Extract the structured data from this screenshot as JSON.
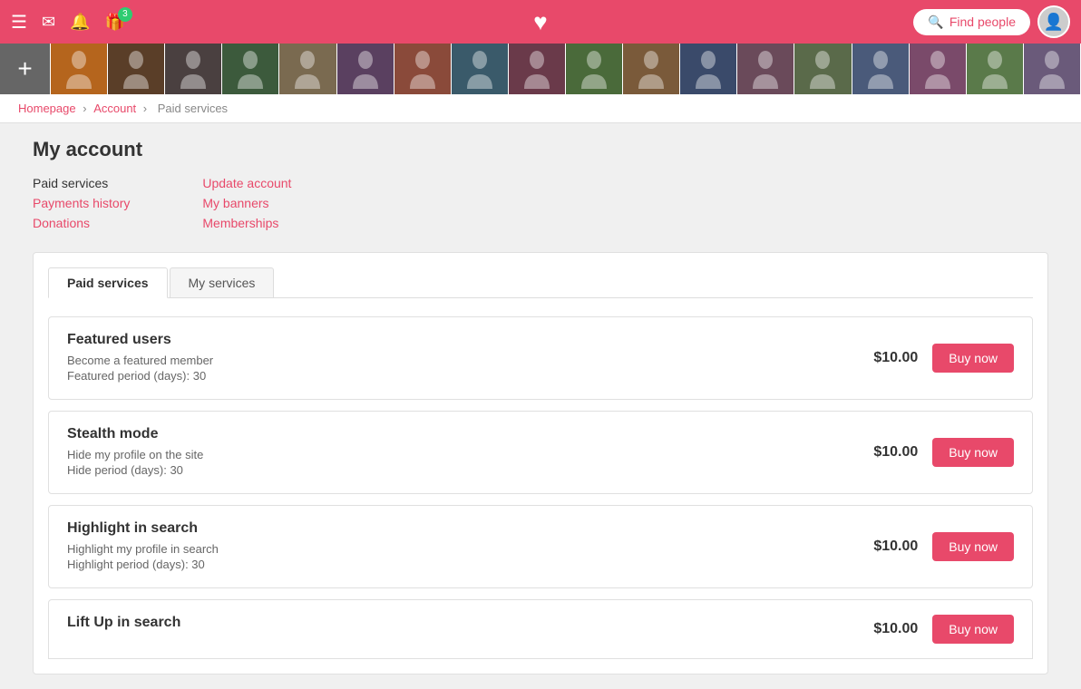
{
  "topnav": {
    "hamburger": "☰",
    "envelope": "✉",
    "bell": "🔔",
    "gift": "🎁",
    "badge_count": "3",
    "heart": "♥",
    "find_people_label": "Find people",
    "avatar_placeholder": "👤"
  },
  "photo_strip": {
    "add_label": "+",
    "photos": [
      {
        "color": "p1",
        "id": "photo-1"
      },
      {
        "color": "p2",
        "id": "photo-2"
      },
      {
        "color": "p3",
        "id": "photo-3"
      },
      {
        "color": "p4",
        "id": "photo-4"
      },
      {
        "color": "p5",
        "id": "photo-5"
      },
      {
        "color": "p6",
        "id": "photo-6"
      },
      {
        "color": "p7",
        "id": "photo-7"
      },
      {
        "color": "p8",
        "id": "photo-8"
      },
      {
        "color": "p9",
        "id": "photo-9"
      },
      {
        "color": "p10",
        "id": "photo-10"
      },
      {
        "color": "p11",
        "id": "photo-11"
      },
      {
        "color": "p12",
        "id": "photo-12"
      },
      {
        "color": "p13",
        "id": "photo-13"
      },
      {
        "color": "p14",
        "id": "photo-14"
      },
      {
        "color": "p15",
        "id": "photo-15"
      },
      {
        "color": "p16",
        "id": "photo-16"
      },
      {
        "color": "p17",
        "id": "photo-17"
      },
      {
        "color": "p18",
        "id": "photo-18"
      }
    ]
  },
  "breadcrumb": {
    "homepage": "Homepage",
    "account": "Account",
    "current": "Paid services"
  },
  "page": {
    "title": "My account"
  },
  "account_menu": {
    "col1": [
      {
        "type": "text",
        "label": "Paid services"
      },
      {
        "type": "link",
        "label": "Payments history"
      },
      {
        "type": "link",
        "label": "Donations"
      }
    ],
    "col2": [
      {
        "type": "link",
        "label": "Update account"
      },
      {
        "type": "link",
        "label": "My banners"
      },
      {
        "type": "link",
        "label": "Memberships"
      }
    ]
  },
  "tabs": [
    {
      "label": "Paid services",
      "active": true
    },
    {
      "label": "My services",
      "active": false
    }
  ],
  "services": [
    {
      "name": "Featured users",
      "desc1": "Become a featured member",
      "desc2": "Featured period (days): 30",
      "price": "$10.00",
      "buy_label": "Buy now"
    },
    {
      "name": "Stealth mode",
      "desc1": "Hide my profile on the site",
      "desc2": "Hide period (days): 30",
      "price": "$10.00",
      "buy_label": "Buy now"
    },
    {
      "name": "Highlight in search",
      "desc1": "Highlight my profile in search",
      "desc2": "Highlight period (days): 30",
      "price": "$10.00",
      "buy_label": "Buy now"
    },
    {
      "name": "Lift Up in search",
      "desc1": "",
      "desc2": "",
      "price": "$10.00",
      "buy_label": "Buy now"
    }
  ]
}
